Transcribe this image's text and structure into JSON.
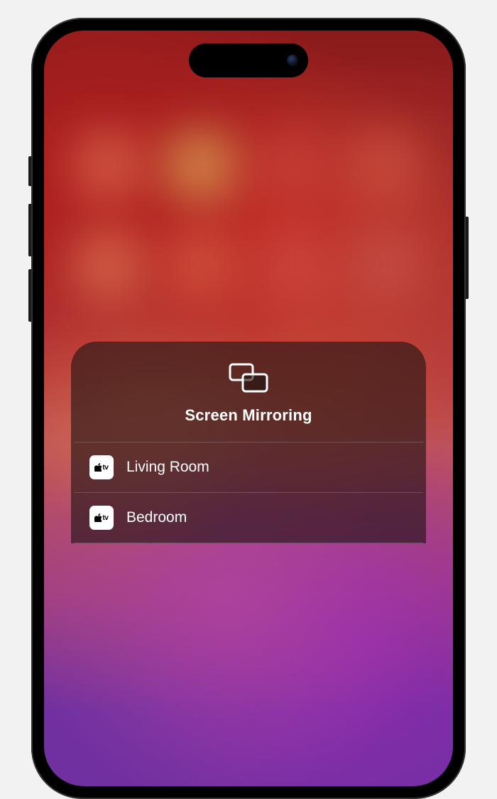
{
  "sheet": {
    "title": "Screen Mirroring",
    "icon": "screen-mirroring-icon",
    "devices": [
      {
        "label": "Living Room",
        "badge_text": "tv",
        "icon": "apple-tv-icon"
      },
      {
        "label": "Bedroom",
        "badge_text": "tv",
        "icon": "apple-tv-icon"
      }
    ]
  }
}
